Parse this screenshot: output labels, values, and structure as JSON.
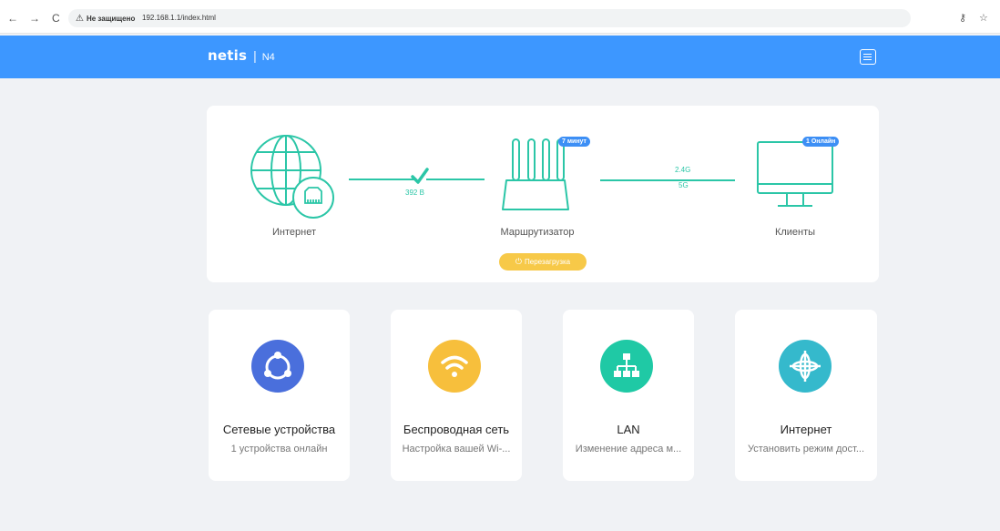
{
  "browser": {
    "security_warning": "Не защищено",
    "url": "192.168.1.1/index.html"
  },
  "header": {
    "logo": "netis",
    "separator": "|",
    "model": "N4"
  },
  "status": {
    "internet_label": "Интернет",
    "speed": "392 B",
    "router_label": "Маршрутизатор",
    "uptime_badge": "7 минут",
    "band_24": "2.4G",
    "band_5": "5G",
    "clients_label": "Клиенты",
    "clients_badge": "1 Онлайн",
    "reboot_label": "Перезагрузка"
  },
  "cards": [
    {
      "title": "Сетевые устройства",
      "desc": "1 устройства онлайн",
      "icon": "network-devices-icon",
      "color": "#4a6fdc"
    },
    {
      "title": "Беспроводная сеть",
      "desc": "Настройка вашей Wi-...",
      "icon": "wifi-icon",
      "color": "#f7bf3c"
    },
    {
      "title": "LAN",
      "desc": "Изменение адреса м...",
      "icon": "lan-icon",
      "color": "#1fc9a5"
    },
    {
      "title": "Интернет",
      "desc": "Установить режим дост...",
      "icon": "internet-globe-icon",
      "color": "#35b9cc"
    }
  ],
  "colors": {
    "accent": "#3d97ff",
    "teal": "#2bc6a7",
    "reboot": "#f7c948",
    "badge": "#3d8ff5"
  }
}
